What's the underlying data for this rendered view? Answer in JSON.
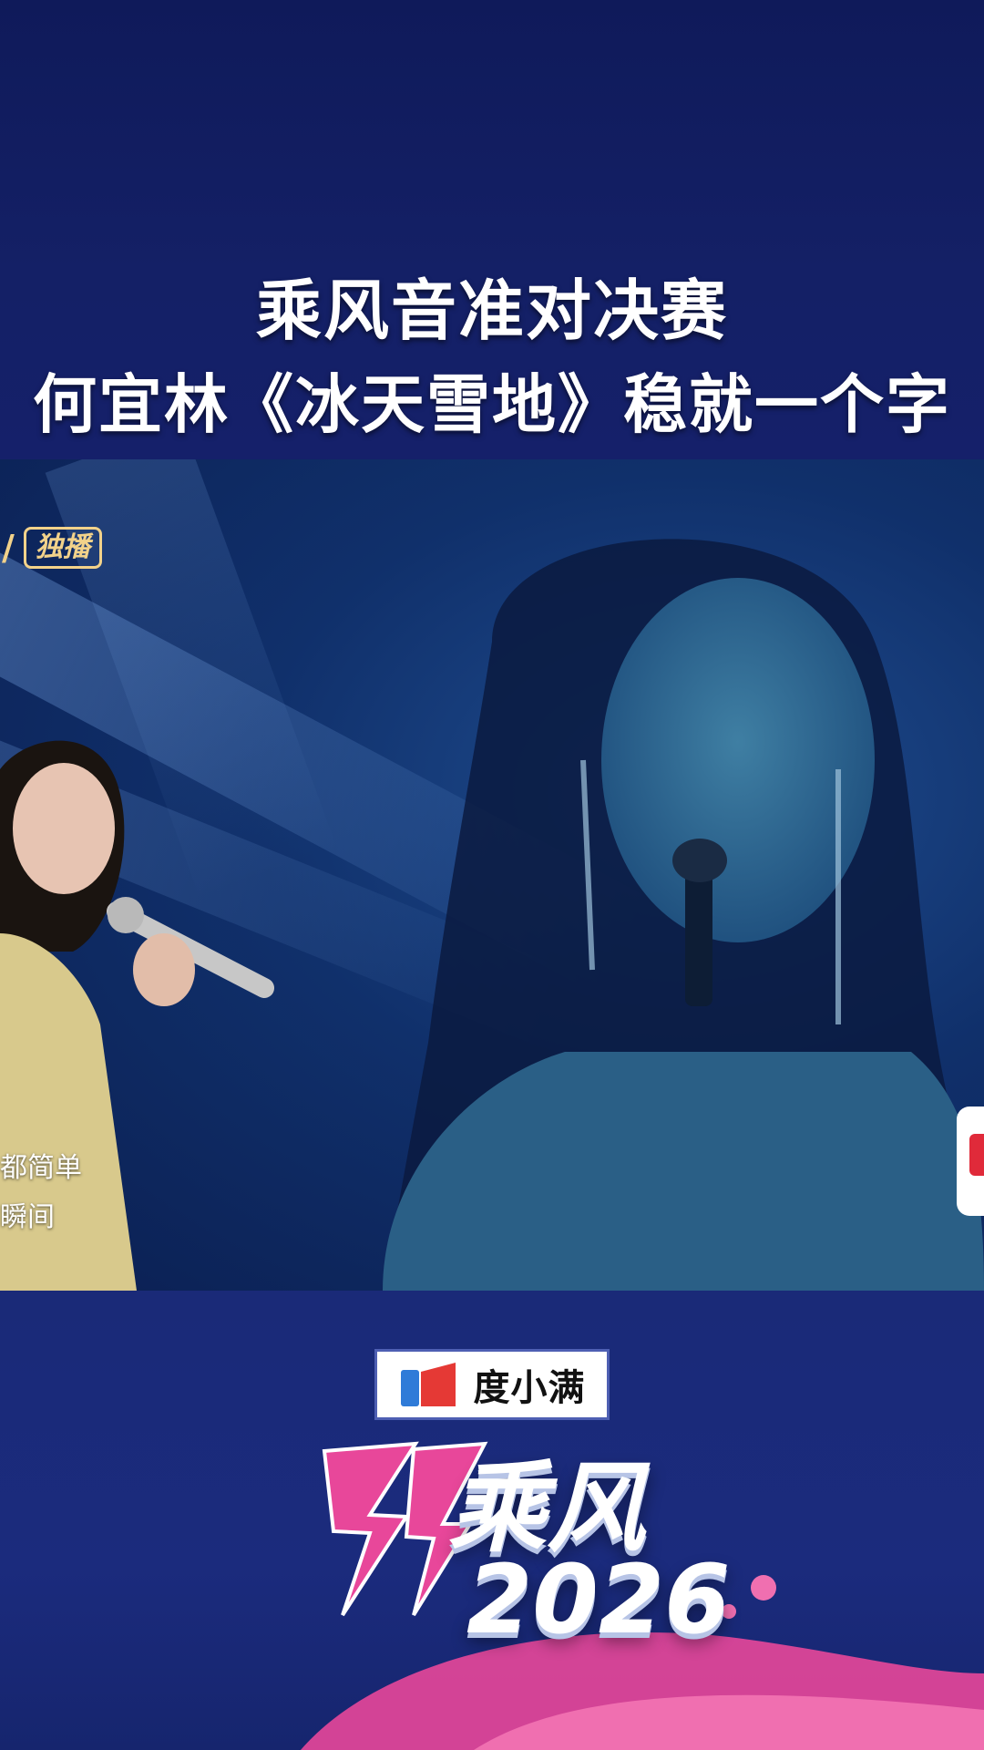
{
  "headline": {
    "line1": "乘风音准对决赛",
    "line2": "何宜林《冰天雪地》稳就一个字"
  },
  "video": {
    "badge_label": "独播",
    "subtitle_line1": "都简单",
    "subtitle_line2": "瞬间"
  },
  "branding": {
    "sponsor_name": "度小满",
    "show_title": "乘风",
    "show_year": "2026"
  },
  "colors": {
    "background": "#141f5e",
    "badge_gold": "#f2d28a",
    "brand_pink": "#e8479a",
    "sponsor_red": "#e53935",
    "sponsor_blue": "#2f7bd8"
  },
  "icons": [
    "sponsor-logo-icon",
    "show-logo-30-icon",
    "side-panel-button"
  ]
}
